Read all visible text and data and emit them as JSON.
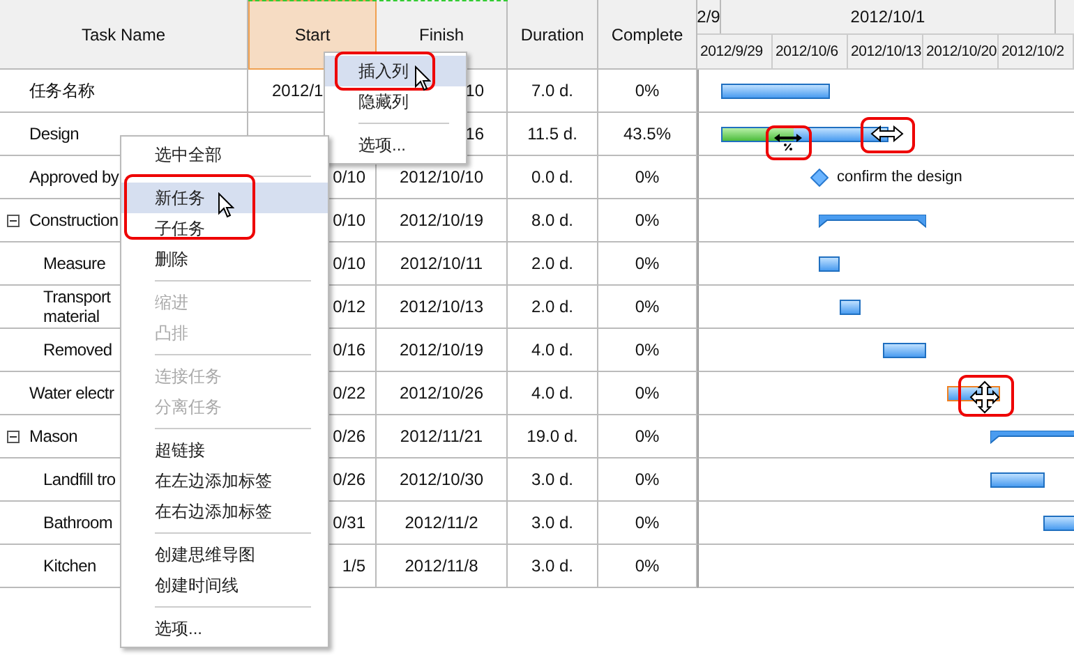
{
  "columns": [
    {
      "label": "Task Name",
      "selected": false
    },
    {
      "label": "Start",
      "selected": true
    },
    {
      "label": "Finish",
      "selected": false
    },
    {
      "label": "Duration",
      "selected": false
    },
    {
      "label": "Complete",
      "selected": false
    }
  ],
  "timescale": {
    "months": [
      "2/9",
      "2012/10/1"
    ],
    "weeks": [
      "2012/9/29",
      "2012/10/6",
      "2012/10/13",
      "2012/10/20",
      "2012/10/2"
    ]
  },
  "tasks": [
    {
      "name": "任务名称",
      "start": "2012/1",
      "finish": "10",
      "duration": "7.0 d.",
      "complete": "0%",
      "bar": {
        "kind": "bar",
        "level": 0,
        "selected": false
      }
    },
    {
      "name": "Design",
      "finish": "16",
      "duration": "11.5 d.",
      "complete": "43.5%",
      "bar": {
        "kind": "bar",
        "level": 0.435,
        "selected": false
      }
    },
    {
      "name": "Approved by",
      "start": "0/10",
      "finish": "2012/10/10",
      "duration": "0.0 d.",
      "complete": "0%",
      "bar": {
        "kind": "milestone",
        "label": "confirm the design"
      }
    },
    {
      "name": "Construction",
      "expanded": true,
      "start": "0/10",
      "finish": "2012/10/19",
      "duration": "8.0 d.",
      "complete": "0%",
      "bar": {
        "kind": "summary"
      },
      "children": [
        {
          "name": "Measure",
          "start": "0/10",
          "finish": "2012/10/11",
          "duration": "2.0 d.",
          "complete": "0%",
          "bar": {
            "kind": "bar",
            "level": 0,
            "selected": false
          }
        },
        {
          "name": "Transport\nmaterial",
          "start": "0/12",
          "finish": "2012/10/13",
          "duration": "2.0 d.",
          "complete": "0%",
          "bar": {
            "kind": "bar",
            "level": 0,
            "selected": false
          }
        },
        {
          "name": "Removed",
          "start": "0/16",
          "finish": "2012/10/19",
          "duration": "4.0 d.",
          "complete": "0%",
          "bar": {
            "kind": "bar",
            "level": 0,
            "selected": false
          }
        }
      ]
    },
    {
      "name": "Water electr",
      "start": "0/22",
      "finish": "2012/10/26",
      "duration": "4.0 d.",
      "complete": "0%",
      "bar": {
        "kind": "bar",
        "level": 0,
        "selected": true
      }
    },
    {
      "name": "Mason",
      "expanded": true,
      "start": "0/26",
      "finish": "2012/11/21",
      "duration": "19.0 d.",
      "complete": "0%",
      "bar": {
        "kind": "summary"
      },
      "children": [
        {
          "name": "Landfill tro",
          "start": "0/26",
          "finish": "2012/10/30",
          "duration": "3.0 d.",
          "complete": "0%",
          "bar": {
            "kind": "bar",
            "level": 0,
            "selected": false
          }
        },
        {
          "name": "Bathroom",
          "start": "0/31",
          "finish": "2012/11/2",
          "duration": "3.0 d.",
          "complete": "0%",
          "bar": {
            "kind": "bar",
            "level": 0,
            "selected": false
          }
        },
        {
          "name": "Kitchen",
          "start": "1/5",
          "finish": "2012/11/8",
          "duration": "3.0 d.",
          "complete": "0%"
        }
      ]
    }
  ],
  "menus": [
    {
      "items": [
        {
          "kind": "item",
          "label": "插入列",
          "selected": true,
          "disabled": false
        },
        {
          "kind": "item",
          "label": "隐藏列",
          "selected": false,
          "disabled": false
        },
        {
          "kind": "separator"
        },
        {
          "kind": "item",
          "label": "选项...",
          "selected": false,
          "disabled": false
        }
      ]
    },
    {
      "items": [
        {
          "kind": "item",
          "label": "选中全部",
          "selected": false,
          "disabled": false
        },
        {
          "kind": "separator"
        },
        {
          "kind": "item",
          "label": "新任务",
          "selected": true,
          "disabled": false
        },
        {
          "kind": "item",
          "label": "子任务",
          "selected": false,
          "disabled": false
        },
        {
          "kind": "item",
          "label": "删除",
          "selected": false,
          "disabled": false
        },
        {
          "kind": "separator"
        },
        {
          "kind": "item",
          "label": "缩进",
          "selected": false,
          "disabled": true
        },
        {
          "kind": "item",
          "label": "凸排",
          "selected": false,
          "disabled": true
        },
        {
          "kind": "separator"
        },
        {
          "kind": "item",
          "label": "连接任务",
          "selected": false,
          "disabled": true
        },
        {
          "kind": "item",
          "label": "分离任务",
          "selected": false,
          "disabled": true
        },
        {
          "kind": "separator"
        },
        {
          "kind": "item",
          "label": "超链接",
          "selected": false,
          "disabled": false
        },
        {
          "kind": "item",
          "label": "在左边添加标签",
          "selected": false,
          "disabled": false
        },
        {
          "kind": "item",
          "label": "在右边添加标签",
          "selected": false,
          "disabled": false
        },
        {
          "kind": "separator"
        },
        {
          "kind": "item",
          "label": "创建思维导图",
          "selected": false,
          "disabled": false
        },
        {
          "kind": "item",
          "label": "创建时间线",
          "selected": false,
          "disabled": false
        },
        {
          "kind": "separator"
        },
        {
          "kind": "item",
          "label": "选项...",
          "selected": false,
          "disabled": false
        }
      ]
    }
  ]
}
